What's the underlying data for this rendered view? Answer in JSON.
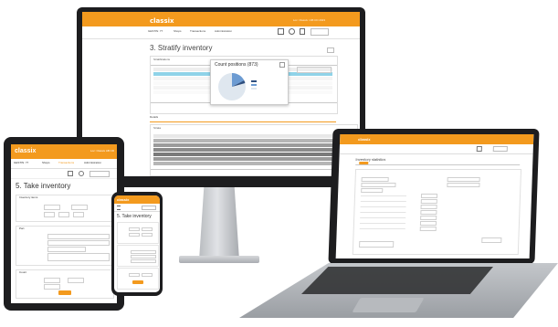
{
  "monitor": {
    "brand": "classix",
    "header_right": "Loc: Classix / AB CD 2023",
    "id_field": "GESTIN: 77",
    "nav": [
      "Shops",
      "Transactions",
      "Administration"
    ],
    "page_title": "3. Stratify inventory",
    "tab_stratifications": "Stratifications",
    "section_details": "Details",
    "strata_label": "Strata",
    "popup_title": "Count positions (873)",
    "pie": {
      "primary_share": 0.82,
      "secondary_share": 0.15,
      "tertiary_share": 0.03
    },
    "colors": {
      "accent": "#f39a1e",
      "selected_row": "#8fd3e8",
      "pie_main": "#dfe7ef",
      "pie_alt": "#6c9bd2",
      "pie_dark": "#2f4f7f"
    }
  },
  "tablet": {
    "brand": "classix",
    "header_right": "Loc: Classix AB CD",
    "id_field": "GESTIN: 77",
    "nav": [
      "Shops",
      "Transactions",
      "Administration"
    ],
    "page_title": "5. Take inventory",
    "sec_inventory": "Inventory items",
    "sec_part": "Part",
    "sec_count": "Count"
  },
  "phone": {
    "brand": "classix",
    "page_title": "5. Take inventory"
  },
  "laptop": {
    "brand": "classix",
    "page_title": "Inventory statistics"
  }
}
